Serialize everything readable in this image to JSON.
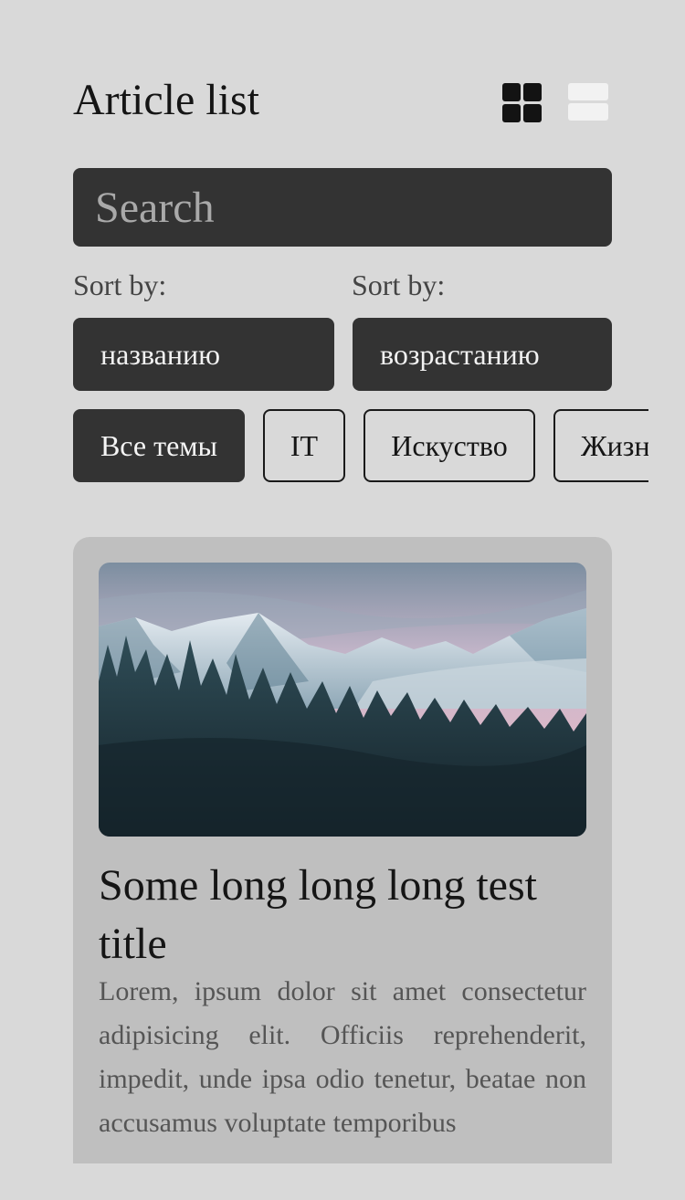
{
  "header": {
    "title": "Article list",
    "view_grid_icon": "grid-view-icon",
    "view_list_icon": "list-view-icon"
  },
  "search": {
    "placeholder": "Search",
    "value": ""
  },
  "sort": {
    "field_label": "Sort by:",
    "field_value": "названию",
    "order_label": "Sort by:",
    "order_value": "возрастанию"
  },
  "tags": [
    {
      "label": "Все темы",
      "active": true
    },
    {
      "label": "IT",
      "active": false
    },
    {
      "label": "Искуство",
      "active": false
    },
    {
      "label": "Жизнь",
      "active": false
    }
  ],
  "colors": {
    "background": "#d9d9d9",
    "dark": "#333333",
    "card": "#bfbfbf"
  },
  "article": {
    "image": "mountain-forest-image",
    "title": "Some long long long test title",
    "text": "Lorem, ipsum dolor sit amet consectetur adipisicing elit. Officiis reprehenderit, impedit, unde ipsa odio tenetur, beatae non accusamus voluptate temporibus"
  }
}
